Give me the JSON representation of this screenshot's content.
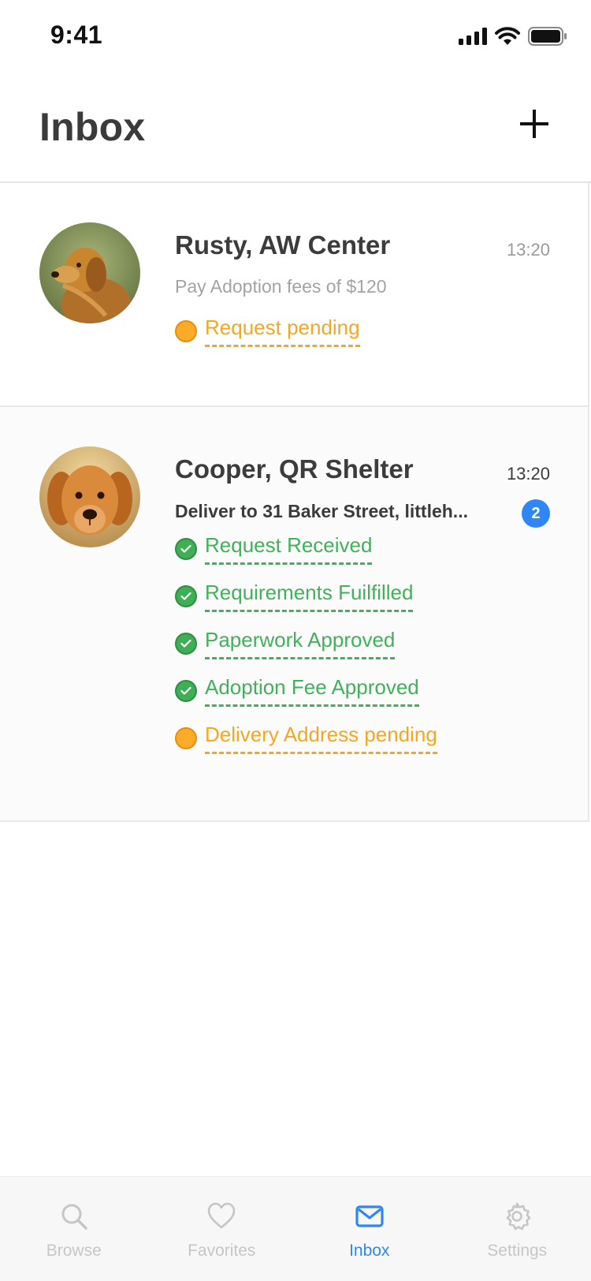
{
  "status_bar": {
    "time": "9:41"
  },
  "header": {
    "title": "Inbox",
    "add_icon": "plus-icon"
  },
  "messages": [
    {
      "sender": "Rusty, AW Center",
      "time": "13:20",
      "preview": "Pay Adoption fees of $120",
      "avatar": "dog-avatar-rusty",
      "statuses": [
        {
          "label": "Request pending",
          "state": "pending"
        }
      ]
    },
    {
      "sender": "Cooper, QR Shelter",
      "time": "13:20",
      "preview": "Deliver to 31 Baker Street, littleh...",
      "avatar": "dog-avatar-cooper",
      "badge": "2",
      "statuses": [
        {
          "label": "Request Received",
          "state": "done"
        },
        {
          "label": "Requirements Fuilfilled",
          "state": "done"
        },
        {
          "label": "Paperwork Approved",
          "state": "done"
        },
        {
          "label": "Adoption Fee Approved",
          "state": "done"
        },
        {
          "label": "Delivery Address pending",
          "state": "pending"
        }
      ]
    }
  ],
  "tab_bar": {
    "tabs": [
      {
        "label": "Browse",
        "icon": "search-icon",
        "active": false
      },
      {
        "label": "Favorites",
        "icon": "heart-icon",
        "active": false
      },
      {
        "label": "Inbox",
        "icon": "mail-icon",
        "active": true
      },
      {
        "label": "Settings",
        "icon": "gear-icon",
        "active": false
      }
    ]
  },
  "colors": {
    "accent": "#2f86f6",
    "pending": "#f8a621",
    "done": "#40b259",
    "text": "#3b3b3b",
    "muted": "#a3a3a3"
  }
}
